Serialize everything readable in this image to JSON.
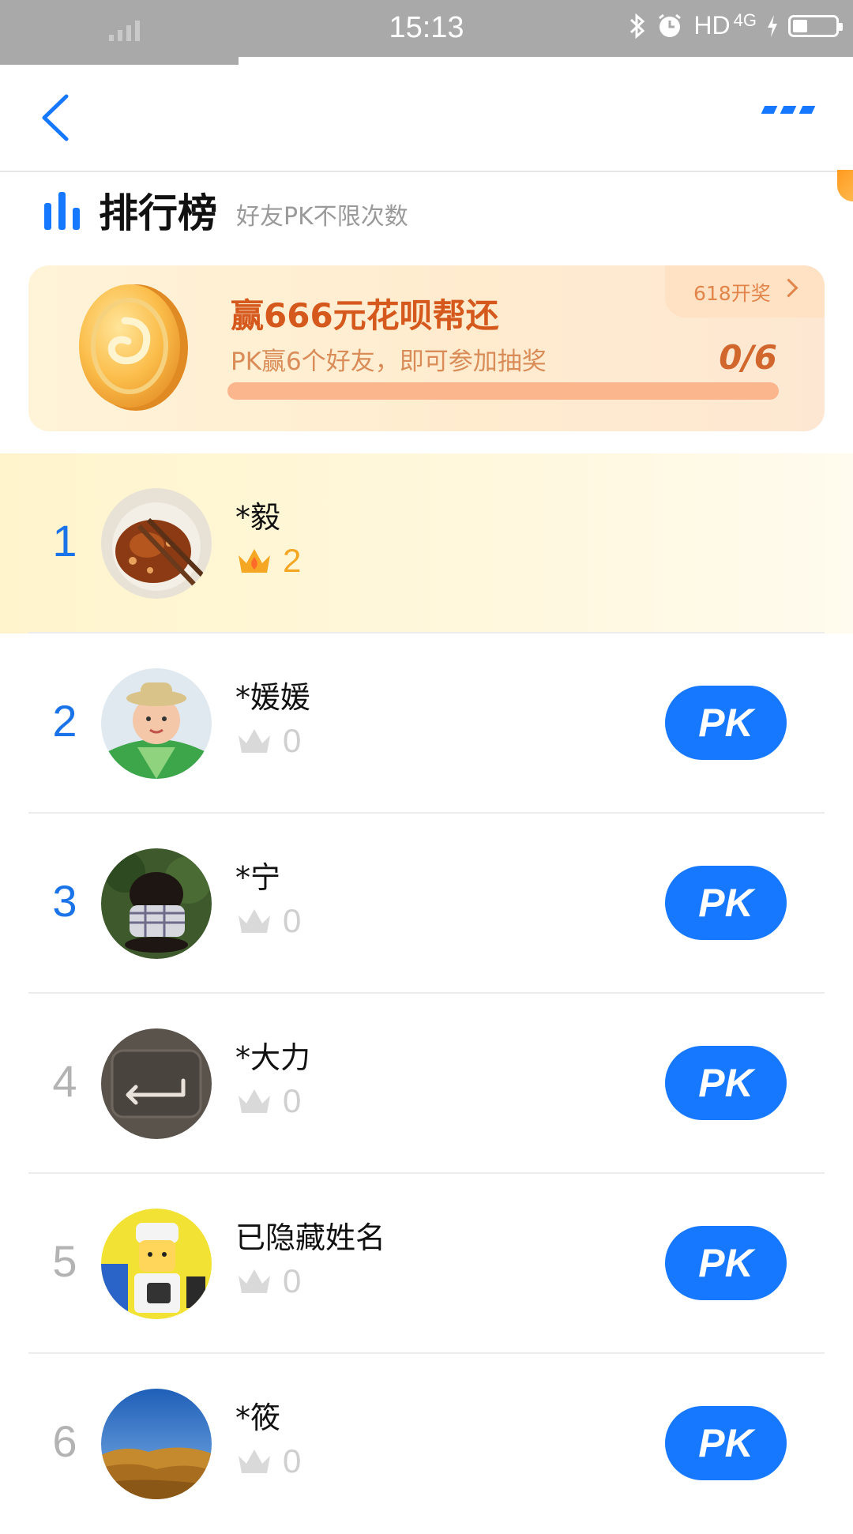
{
  "status_bar": {
    "time": "15:13",
    "network": "HD",
    "signal_type": "4G"
  },
  "header": {
    "title": "排行榜",
    "subtitle": "好友PK不限次数"
  },
  "promo": {
    "title": "赢666元花呗帮还",
    "description": "PK赢6个好友，即可参加抽奖",
    "tag": "618开奖",
    "progress_text": "0/6",
    "progress_done": 0,
    "progress_total": 6
  },
  "rankings": [
    {
      "rank": "1",
      "name": "*毅",
      "score": "2",
      "pk_label": ""
    },
    {
      "rank": "2",
      "name": "*媛媛",
      "score": "0",
      "pk_label": "PK"
    },
    {
      "rank": "3",
      "name": "*宁",
      "score": "0",
      "pk_label": "PK"
    },
    {
      "rank": "4",
      "name": "*大力",
      "score": "0",
      "pk_label": "PK"
    },
    {
      "rank": "5",
      "name": "已隐藏姓名",
      "score": "0",
      "pk_label": "PK"
    },
    {
      "rank": "6",
      "name": "*筱",
      "score": "0",
      "pk_label": "PK"
    }
  ],
  "avatars": [
    "food",
    "baby",
    "dog",
    "enter-key",
    "lego",
    "landscape"
  ],
  "colors": {
    "accent": "#1677ff",
    "promo_text": "#d5581c",
    "gold": "#f5a623",
    "inactive": "#cfcfcf"
  }
}
